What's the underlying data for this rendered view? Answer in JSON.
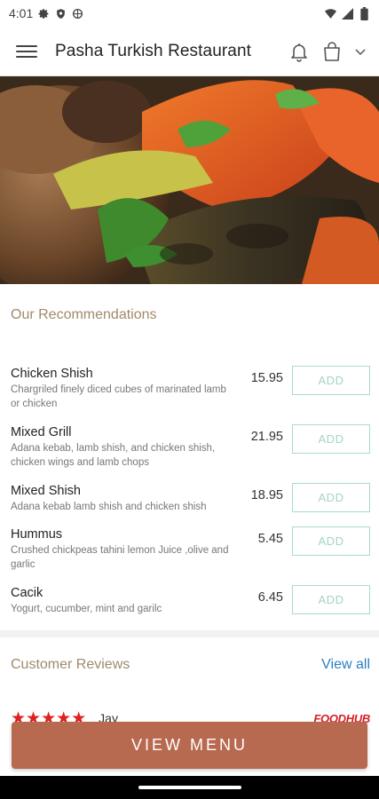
{
  "status": {
    "time": "4:01",
    "icons_left": [
      "gear-icon",
      "shield-icon",
      "vpn-icon"
    ],
    "icons_right": [
      "wifi-icon",
      "signal-icon",
      "battery-icon"
    ]
  },
  "header": {
    "title": "Pasha Turkish Restaurant",
    "icons": [
      "menu-icon",
      "bell-icon",
      "bag-icon",
      "chevron-down-icon"
    ]
  },
  "recommendations": {
    "title": "Our Recommendations",
    "items": [
      {
        "name": "Chicken Shish",
        "desc": "Chargriled finely diced cubes of marinated lamb or chicken",
        "price": "15.95",
        "add": "ADD"
      },
      {
        "name": "Mixed Grill",
        "desc": "Adana kebab, lamb shish, and chicken shish, chicken wings and lamb chops",
        "price": "21.95",
        "add": "ADD"
      },
      {
        "name": "Mixed Shish",
        "desc": "Adana kebab lamb shish and chicken shish",
        "price": "18.95",
        "add": "ADD"
      },
      {
        "name": "Hummus",
        "desc": "Crushed chickpeas tahini lemon Juice ,olive and garlic",
        "price": "5.45",
        "add": "ADD"
      },
      {
        "name": "Cacik",
        "desc": "Yogurt, cucumber, mint and garilc",
        "price": "6.45",
        "add": "ADD"
      }
    ]
  },
  "reviews": {
    "title": "Customer Reviews",
    "view_all": "View all",
    "first": {
      "rating": 5,
      "stars": "★★★★★",
      "reviewer": "Jay",
      "source": "FOODHUB"
    }
  },
  "cta": {
    "label": "VIEW MENU"
  },
  "colors": {
    "accent_gold": "#a08a6a",
    "add_green": "#a8dcc6",
    "link_blue": "#2d7fc1",
    "cta_brown": "#b86a50",
    "star_red": "#e02020"
  }
}
